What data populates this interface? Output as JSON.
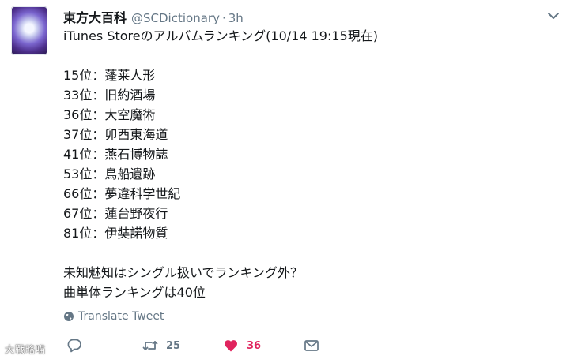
{
  "tweet": {
    "display_name": "東方大百科",
    "handle": "@SCDictionary",
    "separator": "·",
    "time": "3h",
    "lines": [
      "iTunes Storeのアルバムランキング(10/14 19:15現在)",
      "",
      "15位：蓬莱人形",
      "33位：旧約酒場",
      "36位：大空魔術",
      "37位：卯酉東海道",
      "41位：燕石博物誌",
      "53位：鳥船遺跡",
      "66位：夢違科学世紀",
      "67位：蓮台野夜行",
      "81位：伊奘諾物質",
      "",
      "未知魅知はシングル扱いでランキング外？",
      "曲単体ランキングは40位"
    ],
    "translate_label": "Translate Tweet",
    "retweet_count": "25",
    "like_count": "36",
    "accent_like_color": "#e0245e",
    "text_muted_color": "#657786"
  },
  "watermark": {
    "text": "大戰略喵"
  },
  "icons": {
    "menu": "chevron-down-icon",
    "translate": "globe-icon",
    "reply": "reply-icon",
    "retweet": "retweet-icon",
    "like": "heart-icon",
    "dm": "envelope-icon"
  }
}
